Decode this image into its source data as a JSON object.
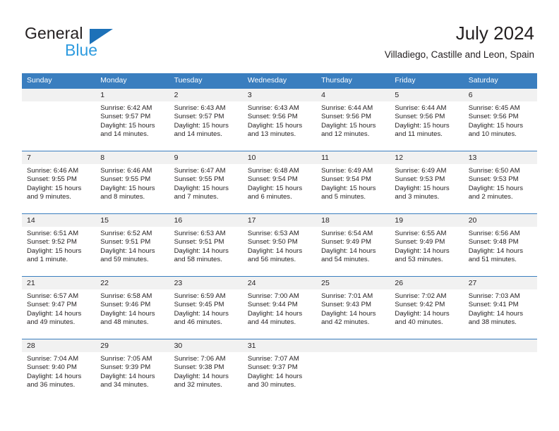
{
  "brand": {
    "name_part1": "General",
    "name_part2": "Blue",
    "triangle_color": "#1d71b8",
    "blue_color": "#2e9bdf"
  },
  "header": {
    "month_title": "July 2024",
    "location": "Villadiego, Castille and Leon, Spain"
  },
  "theme": {
    "header_row_bg": "#3a7ebf",
    "day_band_bg": "#f1f1f1",
    "text_color": "#231f20"
  },
  "weekdays": [
    "Sunday",
    "Monday",
    "Tuesday",
    "Wednesday",
    "Thursday",
    "Friday",
    "Saturday"
  ],
  "weeks": [
    [
      {
        "day": "",
        "sunrise": "",
        "sunset": "",
        "daylight": ""
      },
      {
        "day": "1",
        "sunrise": "Sunrise: 6:42 AM",
        "sunset": "Sunset: 9:57 PM",
        "daylight": "Daylight: 15 hours and 14 minutes."
      },
      {
        "day": "2",
        "sunrise": "Sunrise: 6:43 AM",
        "sunset": "Sunset: 9:57 PM",
        "daylight": "Daylight: 15 hours and 14 minutes."
      },
      {
        "day": "3",
        "sunrise": "Sunrise: 6:43 AM",
        "sunset": "Sunset: 9:56 PM",
        "daylight": "Daylight: 15 hours and 13 minutes."
      },
      {
        "day": "4",
        "sunrise": "Sunrise: 6:44 AM",
        "sunset": "Sunset: 9:56 PM",
        "daylight": "Daylight: 15 hours and 12 minutes."
      },
      {
        "day": "5",
        "sunrise": "Sunrise: 6:44 AM",
        "sunset": "Sunset: 9:56 PM",
        "daylight": "Daylight: 15 hours and 11 minutes."
      },
      {
        "day": "6",
        "sunrise": "Sunrise: 6:45 AM",
        "sunset": "Sunset: 9:56 PM",
        "daylight": "Daylight: 15 hours and 10 minutes."
      }
    ],
    [
      {
        "day": "7",
        "sunrise": "Sunrise: 6:46 AM",
        "sunset": "Sunset: 9:55 PM",
        "daylight": "Daylight: 15 hours and 9 minutes."
      },
      {
        "day": "8",
        "sunrise": "Sunrise: 6:46 AM",
        "sunset": "Sunset: 9:55 PM",
        "daylight": "Daylight: 15 hours and 8 minutes."
      },
      {
        "day": "9",
        "sunrise": "Sunrise: 6:47 AM",
        "sunset": "Sunset: 9:55 PM",
        "daylight": "Daylight: 15 hours and 7 minutes."
      },
      {
        "day": "10",
        "sunrise": "Sunrise: 6:48 AM",
        "sunset": "Sunset: 9:54 PM",
        "daylight": "Daylight: 15 hours and 6 minutes."
      },
      {
        "day": "11",
        "sunrise": "Sunrise: 6:49 AM",
        "sunset": "Sunset: 9:54 PM",
        "daylight": "Daylight: 15 hours and 5 minutes."
      },
      {
        "day": "12",
        "sunrise": "Sunrise: 6:49 AM",
        "sunset": "Sunset: 9:53 PM",
        "daylight": "Daylight: 15 hours and 3 minutes."
      },
      {
        "day": "13",
        "sunrise": "Sunrise: 6:50 AM",
        "sunset": "Sunset: 9:53 PM",
        "daylight": "Daylight: 15 hours and 2 minutes."
      }
    ],
    [
      {
        "day": "14",
        "sunrise": "Sunrise: 6:51 AM",
        "sunset": "Sunset: 9:52 PM",
        "daylight": "Daylight: 15 hours and 1 minute."
      },
      {
        "day": "15",
        "sunrise": "Sunrise: 6:52 AM",
        "sunset": "Sunset: 9:51 PM",
        "daylight": "Daylight: 14 hours and 59 minutes."
      },
      {
        "day": "16",
        "sunrise": "Sunrise: 6:53 AM",
        "sunset": "Sunset: 9:51 PM",
        "daylight": "Daylight: 14 hours and 58 minutes."
      },
      {
        "day": "17",
        "sunrise": "Sunrise: 6:53 AM",
        "sunset": "Sunset: 9:50 PM",
        "daylight": "Daylight: 14 hours and 56 minutes."
      },
      {
        "day": "18",
        "sunrise": "Sunrise: 6:54 AM",
        "sunset": "Sunset: 9:49 PM",
        "daylight": "Daylight: 14 hours and 54 minutes."
      },
      {
        "day": "19",
        "sunrise": "Sunrise: 6:55 AM",
        "sunset": "Sunset: 9:49 PM",
        "daylight": "Daylight: 14 hours and 53 minutes."
      },
      {
        "day": "20",
        "sunrise": "Sunrise: 6:56 AM",
        "sunset": "Sunset: 9:48 PM",
        "daylight": "Daylight: 14 hours and 51 minutes."
      }
    ],
    [
      {
        "day": "21",
        "sunrise": "Sunrise: 6:57 AM",
        "sunset": "Sunset: 9:47 PM",
        "daylight": "Daylight: 14 hours and 49 minutes."
      },
      {
        "day": "22",
        "sunrise": "Sunrise: 6:58 AM",
        "sunset": "Sunset: 9:46 PM",
        "daylight": "Daylight: 14 hours and 48 minutes."
      },
      {
        "day": "23",
        "sunrise": "Sunrise: 6:59 AM",
        "sunset": "Sunset: 9:45 PM",
        "daylight": "Daylight: 14 hours and 46 minutes."
      },
      {
        "day": "24",
        "sunrise": "Sunrise: 7:00 AM",
        "sunset": "Sunset: 9:44 PM",
        "daylight": "Daylight: 14 hours and 44 minutes."
      },
      {
        "day": "25",
        "sunrise": "Sunrise: 7:01 AM",
        "sunset": "Sunset: 9:43 PM",
        "daylight": "Daylight: 14 hours and 42 minutes."
      },
      {
        "day": "26",
        "sunrise": "Sunrise: 7:02 AM",
        "sunset": "Sunset: 9:42 PM",
        "daylight": "Daylight: 14 hours and 40 minutes."
      },
      {
        "day": "27",
        "sunrise": "Sunrise: 7:03 AM",
        "sunset": "Sunset: 9:41 PM",
        "daylight": "Daylight: 14 hours and 38 minutes."
      }
    ],
    [
      {
        "day": "28",
        "sunrise": "Sunrise: 7:04 AM",
        "sunset": "Sunset: 9:40 PM",
        "daylight": "Daylight: 14 hours and 36 minutes."
      },
      {
        "day": "29",
        "sunrise": "Sunrise: 7:05 AM",
        "sunset": "Sunset: 9:39 PM",
        "daylight": "Daylight: 14 hours and 34 minutes."
      },
      {
        "day": "30",
        "sunrise": "Sunrise: 7:06 AM",
        "sunset": "Sunset: 9:38 PM",
        "daylight": "Daylight: 14 hours and 32 minutes."
      },
      {
        "day": "31",
        "sunrise": "Sunrise: 7:07 AM",
        "sunset": "Sunset: 9:37 PM",
        "daylight": "Daylight: 14 hours and 30 minutes."
      },
      {
        "day": "",
        "sunrise": "",
        "sunset": "",
        "daylight": ""
      },
      {
        "day": "",
        "sunrise": "",
        "sunset": "",
        "daylight": ""
      },
      {
        "day": "",
        "sunrise": "",
        "sunset": "",
        "daylight": ""
      }
    ]
  ]
}
